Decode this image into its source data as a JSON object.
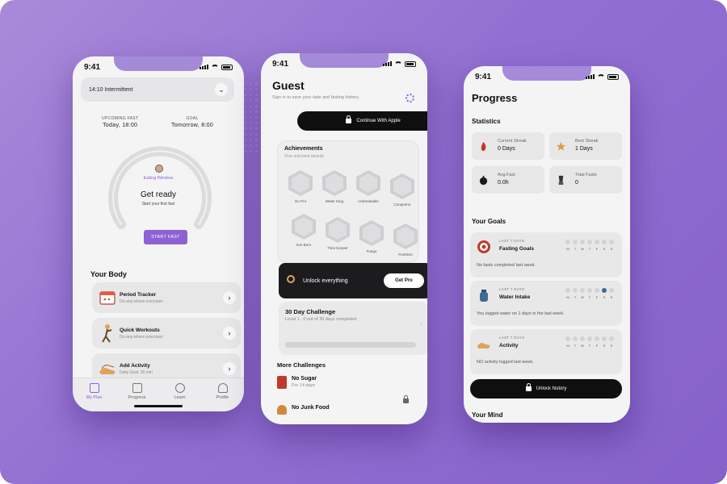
{
  "status": {
    "time": "9:41"
  },
  "plan": {
    "selector": "14:10 Intermittent",
    "upcoming_label": "UPCOMING FAST",
    "upcoming_value": "Today, 18:00",
    "goal_label": "GOAL",
    "goal_value": "Tomorrow, 8:00",
    "window_label": "Eating Window",
    "ready_title": "Get ready",
    "ready_sub": "Start your first fast",
    "start_button": "START FAST",
    "body_title": "Your Body",
    "cards": [
      {
        "title": "Period Tracker",
        "sub": "Do-any where exercises"
      },
      {
        "title": "Quick Workouts",
        "sub": "Do-any where exercises"
      },
      {
        "title": "Add Activity",
        "sub": "Daily Goal: 30 min"
      }
    ],
    "tabs": [
      "My Plan",
      "Progress",
      "Learn",
      "Profile"
    ]
  },
  "guest": {
    "title": "Guest",
    "subtitle": "Sign in to save your date and fasting history.",
    "apple_button": "Continue With Apple",
    "achievements_title": "Achievements",
    "achievements_sub": "Your unlocked awards",
    "badges": [
      "Go Pro",
      "Water King",
      "Unbreakable",
      "Conqueror",
      "Iron Born",
      "Time Keeper",
      "Fuego",
      "Fearless"
    ],
    "unlock_text": "Unlock everything",
    "get_pro": "Get Pro",
    "challenge_title": "30 Day Challenge",
    "challenge_sub": "Level 1 . 0 out of 30 days completed",
    "more_title": "More Challenges",
    "more": [
      {
        "title": "No Sugar",
        "sub": "For 14 days"
      },
      {
        "title": "No Junk Food",
        "sub": ""
      }
    ]
  },
  "progress": {
    "title": "Progress",
    "statistics_title": "Statistics",
    "stats": [
      {
        "label": "Current Streak",
        "value": "0 Days"
      },
      {
        "label": "Best Streak",
        "value": "1 Days"
      },
      {
        "label": "Avg.Fast",
        "value": "0.0h"
      },
      {
        "label": "Total Fasts",
        "value": "0"
      }
    ],
    "goals_title": "Your Goals",
    "week_days": [
      "M",
      "T",
      "W",
      "T",
      "F",
      "S",
      "S"
    ],
    "goals": [
      {
        "label": "LAST 7 DAYS",
        "name": "Fasting Goals",
        "msg": "No fasts completed last week."
      },
      {
        "label": "LAST 7 DAYS",
        "name": "Water Intake",
        "msg": "You logged water on 1 days in the last week."
      },
      {
        "label": "LAST 7 DAYS",
        "name": "Activity",
        "msg": "NO activity logged last week."
      }
    ],
    "unlock_history": "Unlock history",
    "mind_title": "Your Mind"
  },
  "colors": {
    "accent": "#8d62d4",
    "water": "#3f6a96",
    "background": "#9270d2"
  }
}
